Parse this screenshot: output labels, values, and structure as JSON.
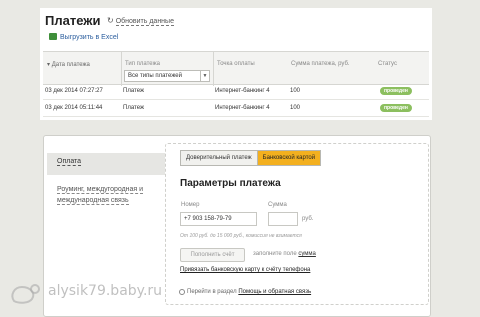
{
  "header": {
    "title": "Платежи",
    "refresh_label": "Обновить данные",
    "export_label": "Выгрузить в Excel"
  },
  "table": {
    "columns": [
      "Дата платежа",
      "Тип платежа",
      "Точка оплаты",
      "Сумма платежа, руб.",
      "Статус"
    ],
    "filter_value": "Все типы платежей",
    "rows": [
      {
        "date": "03 дек 2014  07:27:27",
        "type": "Платеж",
        "point": "Интернет-банкинг 4",
        "sum": "100",
        "status": "проведен"
      },
      {
        "date": "03 дек 2014  05:11:44",
        "type": "Платеж",
        "point": "Интернет-банкинг 4",
        "sum": "100",
        "status": "проведен"
      }
    ]
  },
  "sidebar": {
    "items": [
      {
        "label": "Оплата"
      },
      {
        "label": "Роуминг, междугородная и международная связь"
      }
    ]
  },
  "tabs": [
    {
      "label": "Доверительный платеж"
    },
    {
      "label": "Банковской картой"
    }
  ],
  "form": {
    "title": "Параметры платежа",
    "phone_label": "Номер",
    "phone_value": "+7 903 158-79-79",
    "sum_label": "Сумма",
    "sum_value": "",
    "currency": "руб.",
    "hint": "От 100 руб. до 15 000 руб., комиссия не взимается",
    "submit_label": "Пополнить счёт",
    "fill_prefix": "заполните поле",
    "fill_field": "сумма",
    "bind_card_link": "Привязать банковскую карту к счёту телефона",
    "help_prefix": "Перейти в раздел",
    "help_link": "Помощь и обратная связь"
  },
  "watermark": {
    "text": "alysik79.baby.ru"
  },
  "colors": {
    "status_ok": "#8cbf5f",
    "tab_active": "#f3b01f"
  }
}
